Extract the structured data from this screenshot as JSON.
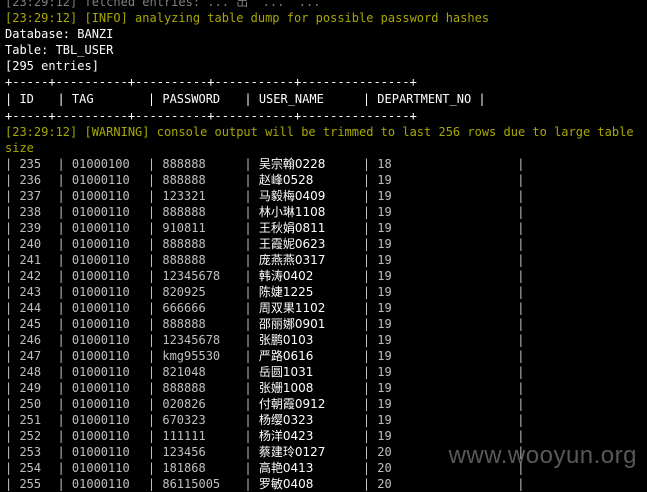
{
  "console": {
    "top_partial": "[23:29:12] fetched entries: ... 出  ...  ...",
    "info_line": "[23:29:12] [INFO] analyzing table dump for possible password hashes",
    "database_line": "Database: BANZI",
    "table_line": "Table: TBL_USER",
    "entries_line": "[295 entries]",
    "border_line": "+-----+----------+----------+-----------+---------------+",
    "header": {
      "id": "ID",
      "tag": "TAG",
      "password": "PASSWORD",
      "user_name": "USER_NAME",
      "department_no": "DEPARTMENT_NO"
    },
    "warning_line": "[23:29:12] [WARNING] console output will be trimmed to last 256 rows due to large table size",
    "rows": [
      {
        "id": "235",
        "tag": "01000100",
        "password": "888888",
        "user_name": "吴宗翰0228",
        "dept": "18"
      },
      {
        "id": "236",
        "tag": "01000110",
        "password": "888888",
        "user_name": "赵峰0528",
        "dept": "19"
      },
      {
        "id": "237",
        "tag": "01000110",
        "password": "123321",
        "user_name": "马毅梅0409",
        "dept": "19"
      },
      {
        "id": "238",
        "tag": "01000110",
        "password": "888888",
        "user_name": "林小琳1108",
        "dept": "19"
      },
      {
        "id": "239",
        "tag": "01000110",
        "password": "910811",
        "user_name": "王秋娟0811",
        "dept": "19"
      },
      {
        "id": "240",
        "tag": "01000110",
        "password": "888888",
        "user_name": "王霞妮0623",
        "dept": "19"
      },
      {
        "id": "241",
        "tag": "01000110",
        "password": "888888",
        "user_name": "庞燕燕0317",
        "dept": "19"
      },
      {
        "id": "242",
        "tag": "01000110",
        "password": "12345678",
        "user_name": "韩涛0402",
        "dept": "19"
      },
      {
        "id": "243",
        "tag": "01000110",
        "password": "820925",
        "user_name": "陈婕1225",
        "dept": "19"
      },
      {
        "id": "244",
        "tag": "01000110",
        "password": "666666",
        "user_name": "周双果1102",
        "dept": "19"
      },
      {
        "id": "245",
        "tag": "01000110",
        "password": "888888",
        "user_name": "邵丽娜0901",
        "dept": "19"
      },
      {
        "id": "246",
        "tag": "01000110",
        "password": "12345678",
        "user_name": "张鹏0103",
        "dept": "19"
      },
      {
        "id": "247",
        "tag": "01000110",
        "password": "kmg95530",
        "user_name": "严路0616",
        "dept": "19"
      },
      {
        "id": "248",
        "tag": "01000110",
        "password": "821048",
        "user_name": "岳圆1031",
        "dept": "19"
      },
      {
        "id": "249",
        "tag": "01000110",
        "password": "888888",
        "user_name": "张姗1008",
        "dept": "19"
      },
      {
        "id": "250",
        "tag": "01000110",
        "password": "020826",
        "user_name": "付朝霞0912",
        "dept": "19"
      },
      {
        "id": "251",
        "tag": "01000110",
        "password": "670323",
        "user_name": "杨缨0323",
        "dept": "19"
      },
      {
        "id": "252",
        "tag": "01000110",
        "password": "111111",
        "user_name": "杨洋0423",
        "dept": "19"
      },
      {
        "id": "253",
        "tag": "01000110",
        "password": "123456",
        "user_name": "蔡建玲0127",
        "dept": "20"
      },
      {
        "id": "254",
        "tag": "01000110",
        "password": "181868",
        "user_name": "高艳0413",
        "dept": "20"
      },
      {
        "id": "255",
        "tag": "01000110",
        "password": "86115005",
        "user_name": "罗敏0408",
        "dept": "20"
      }
    ]
  },
  "watermark": "www.wooyun.org"
}
